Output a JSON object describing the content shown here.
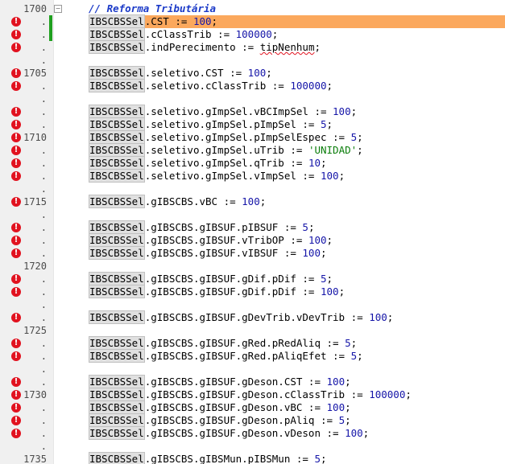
{
  "editor": {
    "lines": [
      {
        "ln": "1700",
        "err": false,
        "mod": false,
        "fold": true,
        "kind": "comment",
        "text": "// Reforma Tributária"
      },
      {
        "ln": ".",
        "err": true,
        "mod": true,
        "current": true,
        "kind": "code",
        "obj": "IBSCBSSel",
        "rest": ".CST := 100;"
      },
      {
        "ln": ".",
        "err": true,
        "mod": true,
        "kind": "code",
        "obj": "IBSCBSSel",
        "rest": ".cClassTrib := 100000;"
      },
      {
        "ln": ".",
        "err": true,
        "mod": false,
        "kind": "code",
        "obj": "IBSCBSSel",
        "rest": ".indPerecimento := ",
        "squig": "tipNenhum",
        "after": ";"
      },
      {
        "ln": ".",
        "err": false,
        "mod": false,
        "kind": "blank"
      },
      {
        "ln": "1705",
        "err": true,
        "mod": false,
        "kind": "code",
        "obj": "IBSCBSSel",
        "rest": ".seletivo.CST := 100;"
      },
      {
        "ln": ".",
        "err": true,
        "mod": false,
        "kind": "code",
        "obj": "IBSCBSSel",
        "rest": ".seletivo.cClassTrib := 100000;"
      },
      {
        "ln": ".",
        "err": false,
        "mod": false,
        "kind": "blank"
      },
      {
        "ln": ".",
        "err": true,
        "mod": false,
        "kind": "code",
        "obj": "IBSCBSSel",
        "rest": ".seletivo.gImpSel.vBCImpSel := 100;"
      },
      {
        "ln": ".",
        "err": true,
        "mod": false,
        "kind": "code",
        "obj": "IBSCBSSel",
        "rest": ".seletivo.gImpSel.pImpSel := 5;"
      },
      {
        "ln": "1710",
        "err": true,
        "mod": false,
        "kind": "code",
        "obj": "IBSCBSSel",
        "rest": ".seletivo.gImpSel.pImpSelEspec := 5;"
      },
      {
        "ln": ".",
        "err": true,
        "mod": false,
        "kind": "code",
        "obj": "IBSCBSSel",
        "rest": ".seletivo.gImpSel.uTrib := 'UNIDAD';"
      },
      {
        "ln": ".",
        "err": true,
        "mod": false,
        "kind": "code",
        "obj": "IBSCBSSel",
        "rest": ".seletivo.gImpSel.qTrib := 10;"
      },
      {
        "ln": ".",
        "err": true,
        "mod": false,
        "kind": "code",
        "obj": "IBSCBSSel",
        "rest": ".seletivo.gImpSel.vImpSel := 100;"
      },
      {
        "ln": ".",
        "err": false,
        "mod": false,
        "kind": "blank"
      },
      {
        "ln": "1715",
        "err": true,
        "mod": false,
        "kind": "code",
        "obj": "IBSCBSSel",
        "rest": ".gIBSCBS.vBC := 100;"
      },
      {
        "ln": ".",
        "err": false,
        "mod": false,
        "kind": "blank"
      },
      {
        "ln": ".",
        "err": true,
        "mod": false,
        "kind": "code",
        "obj": "IBSCBSSel",
        "rest": ".gIBSCBS.gIBSUF.pIBSUF := 5;"
      },
      {
        "ln": ".",
        "err": true,
        "mod": false,
        "kind": "code",
        "obj": "IBSCBSSel",
        "rest": ".gIBSCBS.gIBSUF.vTribOP := 100;"
      },
      {
        "ln": ".",
        "err": true,
        "mod": false,
        "kind": "code",
        "obj": "IBSCBSSel",
        "rest": ".gIBSCBS.gIBSUF.vIBSUF := 100;"
      },
      {
        "ln": "1720",
        "err": false,
        "mod": false,
        "kind": "blank"
      },
      {
        "ln": ".",
        "err": true,
        "mod": false,
        "kind": "code",
        "obj": "IBSCBSSel",
        "rest": ".gIBSCBS.gIBSUF.gDif.pDif := 5;"
      },
      {
        "ln": ".",
        "err": true,
        "mod": false,
        "kind": "code",
        "obj": "IBSCBSSel",
        "rest": ".gIBSCBS.gIBSUF.gDif.pDif := 100;"
      },
      {
        "ln": ".",
        "err": false,
        "mod": false,
        "kind": "blank"
      },
      {
        "ln": ".",
        "err": true,
        "mod": false,
        "kind": "code",
        "obj": "IBSCBSSel",
        "rest": ".gIBSCBS.gIBSUF.gDevTrib.vDevTrib := 100;"
      },
      {
        "ln": "1725",
        "err": false,
        "mod": false,
        "kind": "blank"
      },
      {
        "ln": ".",
        "err": true,
        "mod": false,
        "kind": "code",
        "obj": "IBSCBSSel",
        "rest": ".gIBSCBS.gIBSUF.gRed.pRedAliq := 5;"
      },
      {
        "ln": ".",
        "err": true,
        "mod": false,
        "kind": "code",
        "obj": "IBSCBSSel",
        "rest": ".gIBSCBS.gIBSUF.gRed.pAliqEfet := 5;"
      },
      {
        "ln": ".",
        "err": false,
        "mod": false,
        "kind": "blank"
      },
      {
        "ln": ".",
        "err": true,
        "mod": false,
        "kind": "code",
        "obj": "IBSCBSSel",
        "rest": ".gIBSCBS.gIBSUF.gDeson.CST := 100;"
      },
      {
        "ln": "1730",
        "err": true,
        "mod": false,
        "kind": "code",
        "obj": "IBSCBSSel",
        "rest": ".gIBSCBS.gIBSUF.gDeson.cClassTrib := 100000;"
      },
      {
        "ln": ".",
        "err": true,
        "mod": false,
        "kind": "code",
        "obj": "IBSCBSSel",
        "rest": ".gIBSCBS.gIBSUF.gDeson.vBC := 100;"
      },
      {
        "ln": ".",
        "err": true,
        "mod": false,
        "kind": "code",
        "obj": "IBSCBSSel",
        "rest": ".gIBSCBS.gIBSUF.gDeson.pAliq := 5;"
      },
      {
        "ln": ".",
        "err": true,
        "mod": false,
        "kind": "code",
        "obj": "IBSCBSSel",
        "rest": ".gIBSCBS.gIBSUF.gDeson.vDeson := 100;"
      },
      {
        "ln": ".",
        "err": false,
        "mod": false,
        "kind": "blank"
      },
      {
        "ln": "1735",
        "err": false,
        "mod": false,
        "kind": "code",
        "obj": "IBSCBSSel",
        "rest": ".gIBSCBS.gIBSMun.pIBSMun := 5;"
      }
    ],
    "error_glyph": "!",
    "fold_glyph": "−",
    "colors": {
      "current_line": "#fba85d",
      "error_marker": "#e1121f",
      "modified_bar": "#1fa01f",
      "comment": "#1b3ac8"
    }
  }
}
